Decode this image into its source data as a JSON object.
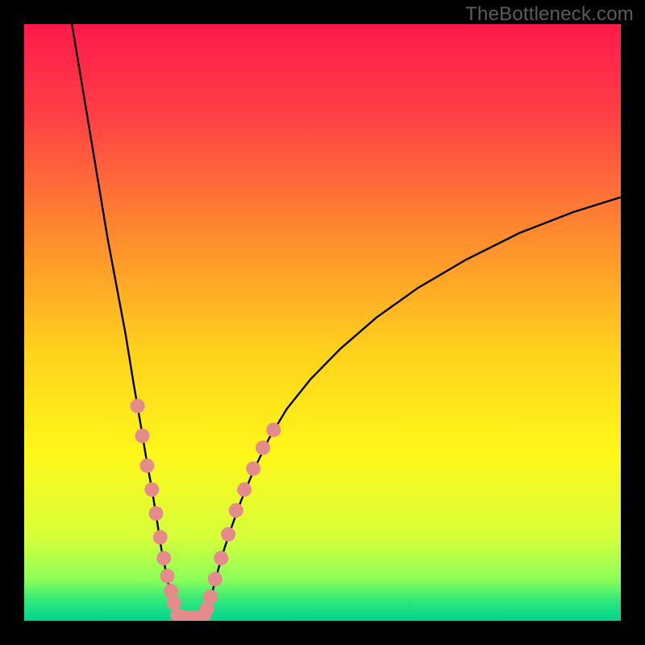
{
  "watermark": "TheBottleneck.com",
  "chart_data": {
    "type": "line",
    "title": "",
    "xlabel": "",
    "ylabel": "",
    "xlim": [
      0,
      100
    ],
    "ylim": [
      0,
      100
    ],
    "grid": false,
    "legend": false,
    "background_gradient": {
      "stops": [
        {
          "offset": 0.0,
          "color": "#ff1a4b"
        },
        {
          "offset": 0.15,
          "color": "#ff3f46"
        },
        {
          "offset": 0.35,
          "color": "#ff8a2e"
        },
        {
          "offset": 0.55,
          "color": "#ffd21c"
        },
        {
          "offset": 0.72,
          "color": "#fff71a"
        },
        {
          "offset": 0.86,
          "color": "#d6ff3a"
        },
        {
          "offset": 0.93,
          "color": "#8dff58"
        },
        {
          "offset": 0.965,
          "color": "#32e87a"
        },
        {
          "offset": 1.0,
          "color": "#00d68f"
        }
      ]
    },
    "series": [
      {
        "name": "left-branch",
        "x": [
          8,
          10,
          12,
          14,
          15.5,
          17,
          18.3,
          19.5,
          20.5,
          21.5,
          22.3,
          23,
          23.7,
          24.3,
          24.9,
          25.3,
          25.7,
          26
        ],
        "y": [
          100,
          88,
          76,
          64,
          56,
          48,
          40,
          33,
          27,
          21.5,
          16.5,
          12,
          8.5,
          5.5,
          3.2,
          1.7,
          0.7,
          0
        ]
      },
      {
        "name": "valley-floor",
        "x": [
          26,
          27,
          28,
          29,
          30
        ],
        "y": [
          0,
          0,
          0,
          0,
          0
        ]
      },
      {
        "name": "right-branch",
        "x": [
          30,
          30.5,
          31.2,
          32,
          33,
          34.5,
          36.3,
          38.5,
          41,
          44,
          48,
          53,
          59,
          66,
          74,
          83,
          92,
          100
        ],
        "y": [
          0,
          1.4,
          3.6,
          6.6,
          10.4,
          15,
          20,
          25.3,
          30.5,
          35.5,
          40.5,
          45.6,
          50.8,
          55.8,
          60.5,
          65,
          68.5,
          71
        ]
      }
    ],
    "markers": {
      "comment": "pink dot markers clustered near the bottom of the V",
      "color": "#e58b8b",
      "radius_px": 9,
      "left_cluster": [
        {
          "x": 19.0,
          "y": 36
        },
        {
          "x": 19.8,
          "y": 31
        },
        {
          "x": 20.6,
          "y": 26
        },
        {
          "x": 21.4,
          "y": 22
        },
        {
          "x": 22.1,
          "y": 18
        },
        {
          "x": 22.8,
          "y": 14
        },
        {
          "x": 23.4,
          "y": 10.5
        },
        {
          "x": 24.0,
          "y": 7.5
        },
        {
          "x": 24.6,
          "y": 5
        },
        {
          "x": 25.1,
          "y": 3
        }
      ],
      "right_cluster": [
        {
          "x": 30.6,
          "y": 2
        },
        {
          "x": 31.2,
          "y": 4
        },
        {
          "x": 32.0,
          "y": 7
        },
        {
          "x": 33.0,
          "y": 10.5
        },
        {
          "x": 34.2,
          "y": 14.5
        },
        {
          "x": 35.5,
          "y": 18.5
        },
        {
          "x": 36.9,
          "y": 22
        },
        {
          "x": 38.4,
          "y": 25.5
        },
        {
          "x": 40.0,
          "y": 29
        },
        {
          "x": 41.8,
          "y": 32
        }
      ],
      "floor_bar": [
        {
          "x": 25.7,
          "y": 0.9
        },
        {
          "x": 26.6,
          "y": 0.6
        },
        {
          "x": 27.5,
          "y": 0.5
        },
        {
          "x": 28.4,
          "y": 0.5
        },
        {
          "x": 29.3,
          "y": 0.6
        },
        {
          "x": 30.1,
          "y": 0.9
        }
      ]
    }
  }
}
